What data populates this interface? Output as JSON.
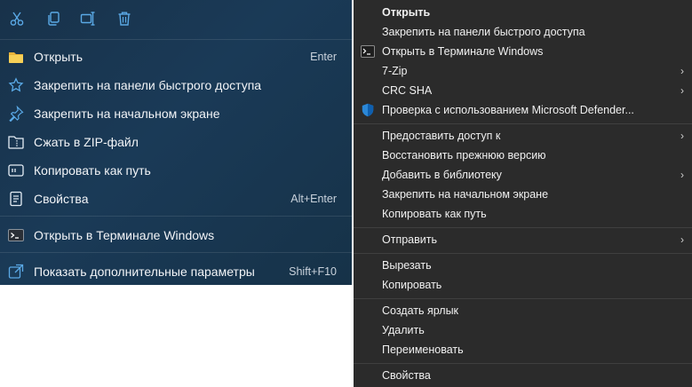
{
  "left_menu": {
    "toolbar": [
      {
        "icon": "cut-icon"
      },
      {
        "icon": "copy-icon"
      },
      {
        "icon": "rename-icon"
      },
      {
        "icon": "delete-icon"
      }
    ],
    "items": [
      {
        "label": "Открыть",
        "shortcut": "Enter",
        "icon": "folder-icon"
      },
      {
        "label": "Закрепить на панели быстрого доступа",
        "shortcut": "",
        "icon": "star-icon"
      },
      {
        "label": "Закрепить на начальном экране",
        "shortcut": "",
        "icon": "pin-icon"
      },
      {
        "label": "Сжать в ZIP-файл",
        "shortcut": "",
        "icon": "zip-icon"
      },
      {
        "label": "Копировать как путь",
        "shortcut": "",
        "icon": "copy-path-icon"
      },
      {
        "label": "Свойства",
        "shortcut": "Alt+Enter",
        "icon": "properties-icon"
      },
      {
        "label": "Открыть в Терминале Windows",
        "shortcut": "",
        "icon": "terminal-icon"
      },
      {
        "label": "Показать дополнительные параметры",
        "shortcut": "Shift+F10",
        "icon": "more-options-icon"
      }
    ]
  },
  "right_menu": {
    "items": [
      {
        "label": "Открыть",
        "bold": true
      },
      {
        "label": "Закрепить на панели быстрого доступа"
      },
      {
        "label": "Открыть в Терминале Windows",
        "icon": "terminal-icon"
      },
      {
        "label": "7-Zip",
        "submenu": true
      },
      {
        "label": "CRC SHA",
        "submenu": true
      },
      {
        "label": "Проверка с использованием Microsoft Defender...",
        "icon": "defender-shield-icon"
      },
      {
        "label": "Предоставить доступ к",
        "submenu": true
      },
      {
        "label": "Восстановить прежнюю версию"
      },
      {
        "label": "Добавить в библиотеку",
        "submenu": true
      },
      {
        "label": "Закрепить на начальном экране"
      },
      {
        "label": "Копировать как путь"
      },
      {
        "label": "Отправить",
        "submenu": true
      },
      {
        "label": "Вырезать"
      },
      {
        "label": "Копировать"
      },
      {
        "label": "Создать ярлык"
      },
      {
        "label": "Удалить"
      },
      {
        "label": "Переименовать"
      },
      {
        "label": "Свойства"
      }
    ],
    "submenu_arrow": "›"
  },
  "colors": {
    "left_bg": "#1a3a57",
    "right_bg": "#2b2b2b",
    "accent": "#4fa3e0"
  }
}
